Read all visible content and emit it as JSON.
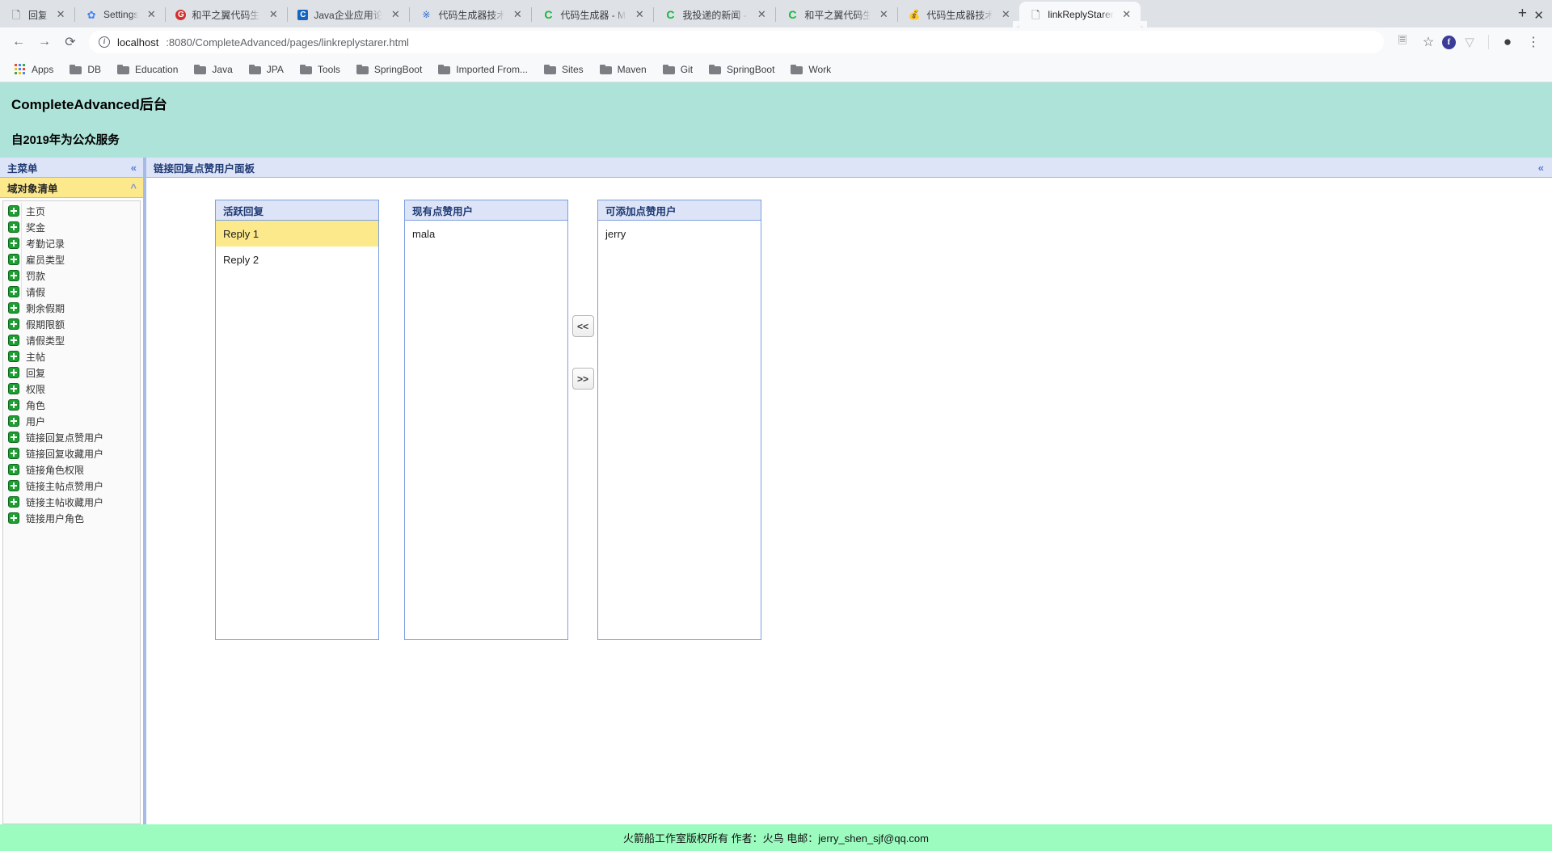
{
  "browser": {
    "tabs": [
      {
        "title": "回复",
        "favicon": "page-icon",
        "active": false
      },
      {
        "title": "Settings",
        "favicon": "gear-icon",
        "active": false
      },
      {
        "title": "和平之翼代码生成",
        "favicon": "g-circle-icon",
        "active": false
      },
      {
        "title": "Java企业应用论坛",
        "favicon": "c-square-icon",
        "active": false
      },
      {
        "title": "代码生成器技术社",
        "favicon": "paw-icon",
        "active": false
      },
      {
        "title": "代码生成器 - MSD",
        "favicon": "csdn-icon",
        "active": false
      },
      {
        "title": "我投递的新闻 - M",
        "favicon": "csdn-icon",
        "active": false
      },
      {
        "title": "和平之翼代码生成",
        "favicon": "csdn-icon",
        "active": false
      },
      {
        "title": "代码生成器技术社",
        "favicon": "moneybag-icon",
        "active": false
      },
      {
        "title": "linkReplyStarer",
        "favicon": "page-icon",
        "active": true
      }
    ],
    "new_tab_label": "+",
    "window_close_label": "✕",
    "close_label": "✕",
    "nav": {
      "back_label": "←",
      "forward_label": "→",
      "reload_label": "⟳",
      "info_label": "i"
    },
    "omnibox": {
      "url_host": "localhost",
      "url_rest": ":8080/CompleteAdvanced/pages/linkreplystarer.html"
    },
    "toolbar_right": [
      {
        "name": "translate-icon",
        "glyph": "🗏"
      },
      {
        "name": "bookmark-star-icon",
        "glyph": "☆"
      },
      {
        "name": "extension-f-icon",
        "glyph": "f"
      },
      {
        "name": "extension-v-icon",
        "glyph": "▽"
      },
      {
        "name": "profile-avatar-icon",
        "glyph": "●"
      },
      {
        "name": "chrome-menu-icon",
        "glyph": "⋮"
      }
    ],
    "bookmarks": [
      {
        "label": "Apps",
        "icon": "apps-grid-icon"
      },
      {
        "label": "DB",
        "icon": "folder-icon"
      },
      {
        "label": "Education",
        "icon": "folder-icon"
      },
      {
        "label": "Java",
        "icon": "folder-icon"
      },
      {
        "label": "JPA",
        "icon": "folder-icon"
      },
      {
        "label": "Tools",
        "icon": "folder-icon"
      },
      {
        "label": "SpringBoot",
        "icon": "folder-icon"
      },
      {
        "label": "Imported From...",
        "icon": "folder-icon"
      },
      {
        "label": "Sites",
        "icon": "folder-icon"
      },
      {
        "label": "Maven",
        "icon": "folder-icon"
      },
      {
        "label": "Git",
        "icon": "folder-icon"
      },
      {
        "label": "SpringBoot",
        "icon": "folder-icon"
      },
      {
        "label": "Work",
        "icon": "folder-icon"
      }
    ]
  },
  "app": {
    "header": {
      "title": "CompleteAdvanced后台",
      "subtitle": "自2019年为公众服务",
      "bg_color": "#aee3da"
    },
    "sidebar": {
      "panel_title": "主菜单",
      "collapse_glyph": "«",
      "accordion_title": "域对象清单",
      "accordion_glyph": "^",
      "items": [
        {
          "label": "主页"
        },
        {
          "label": "奖金"
        },
        {
          "label": "考勤记录"
        },
        {
          "label": "雇员类型"
        },
        {
          "label": "罚款"
        },
        {
          "label": "请假"
        },
        {
          "label": "剩余假期"
        },
        {
          "label": "假期限额"
        },
        {
          "label": "请假类型"
        },
        {
          "label": "主帖"
        },
        {
          "label": "回复"
        },
        {
          "label": "权限"
        },
        {
          "label": "角色"
        },
        {
          "label": "用户"
        },
        {
          "label": "链接回复点赞用户"
        },
        {
          "label": "链接回复收藏用户"
        },
        {
          "label": "链接角色权限"
        },
        {
          "label": "链接主帖点赞用户"
        },
        {
          "label": "链接主帖收藏用户"
        },
        {
          "label": "链接用户角色"
        }
      ]
    },
    "content": {
      "panel_title": "链接回复点赞用户面板",
      "collapse_glyph": "«",
      "lists": [
        {
          "header": "活跃回复",
          "items": [
            {
              "label": "Reply 1",
              "selected": true
            },
            {
              "label": "Reply 2",
              "selected": false
            }
          ]
        },
        {
          "header": "现有点赞用户",
          "items": [
            {
              "label": "mala",
              "selected": false
            }
          ]
        },
        {
          "header": "可添加点赞用户",
          "items": [
            {
              "label": "jerry",
              "selected": false
            }
          ]
        }
      ],
      "transfer_buttons": [
        {
          "name": "move-left-button",
          "label": "<<"
        },
        {
          "name": "move-right-button",
          "label": ">>"
        }
      ]
    },
    "footer": {
      "text": "火箭船工作室版权所有 作者：火鸟 电邮：jerry_shen_sjf@qq.com",
      "bg_color": "#9cfcbf"
    }
  }
}
